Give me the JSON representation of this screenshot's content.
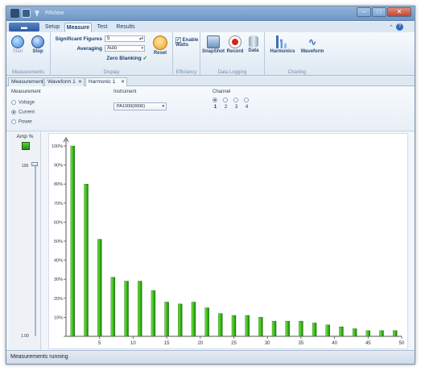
{
  "window": {
    "title": "PAView"
  },
  "menu": {
    "app_button": "▬",
    "tabs": [
      "Setup",
      "Measure",
      "Test",
      "Results"
    ],
    "active_tab": "Measure"
  },
  "ribbon": {
    "measurements": {
      "start": "Start",
      "stop": "Stop",
      "label": "Measurements"
    },
    "display": {
      "sig_figs_label": "Significant Figures",
      "sig_figs_value": "5",
      "averaging_label": "Averaging",
      "averaging_value": "Auto",
      "zero_blanking": "Zero Blanking",
      "reset": "Reset",
      "label": "Display"
    },
    "efficiency": {
      "enable_watts": "Enable Watts",
      "label": "Efficiency"
    },
    "data_logging": {
      "snapshot": "SnapShot",
      "record": "Record",
      "data": "Data",
      "label": "Data Logging"
    },
    "charting": {
      "harmonics": "Harmonics",
      "waveform": "Waveform",
      "label": "Charting"
    }
  },
  "doc_tabs": [
    "Measurement",
    "Waveform 1",
    "Harmonic 1"
  ],
  "active_doc_tab": "Harmonic 1",
  "settings": {
    "measurement_label": "Measurement",
    "options": [
      "Voltage",
      "Current",
      "Power"
    ],
    "selected": "Current",
    "instrument_label": "Instrument",
    "instrument_value": "PA1000(0006)",
    "channel_label": "Channel",
    "channels": [
      "1",
      "2",
      "3",
      "4"
    ],
    "selected_channel": "1"
  },
  "left_panel": {
    "amp_label": "Amp %",
    "slider_top": "100",
    "slider_bottom": "1.00"
  },
  "chart_data": {
    "type": "bar",
    "x": [
      1,
      3,
      5,
      7,
      9,
      11,
      13,
      15,
      17,
      19,
      21,
      23,
      25,
      27,
      29,
      31,
      33,
      35,
      37,
      39,
      41,
      43,
      45,
      47,
      49
    ],
    "values": [
      100,
      80,
      51,
      31,
      29,
      29,
      24,
      18,
      17,
      18,
      15,
      12,
      11,
      11,
      10,
      8,
      8,
      8,
      7,
      6,
      5,
      4,
      3,
      3,
      3
    ],
    "ylim": [
      0,
      100
    ],
    "xlim": [
      0,
      50
    ],
    "yticks": [
      "0%",
      "10%",
      "20%",
      "30%",
      "40%",
      "50%",
      "60%",
      "70%",
      "80%",
      "90%",
      "100%"
    ],
    "xticks": [
      "5",
      "10",
      "15",
      "20",
      "25",
      "30",
      "35",
      "40",
      "45",
      "50"
    ],
    "bar_color": "#3cc21a",
    "grid": false
  },
  "status": {
    "text": "Measurements running"
  }
}
